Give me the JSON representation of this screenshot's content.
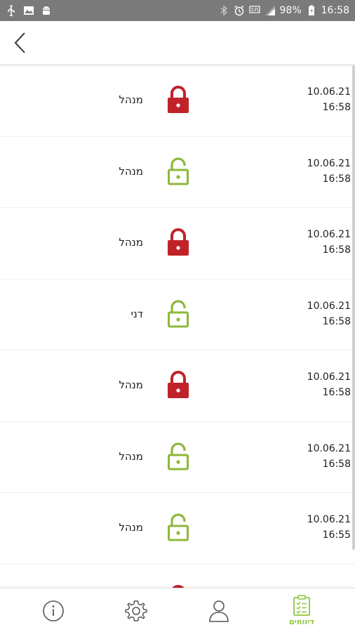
{
  "status_bar": {
    "battery": "98%",
    "time": "16:58",
    "icons": [
      "usb-icon",
      "image-icon",
      "android-icon",
      "bluetooth-icon",
      "alarm-icon",
      "volte-icon",
      "signal-icon",
      "battery-icon"
    ]
  },
  "header": {
    "back_icon": "chevron-left-icon"
  },
  "colors": {
    "locked": "#c0222a",
    "unlocked": "#8db83a",
    "accent": "#8dc63f"
  },
  "log": {
    "rows": [
      {
        "user": "מנהל",
        "state": "locked",
        "date": "10.06.21",
        "time": "16:58"
      },
      {
        "user": "מנהל",
        "state": "unlocked",
        "date": "10.06.21",
        "time": "16:58"
      },
      {
        "user": "מנהל",
        "state": "locked",
        "date": "10.06.21",
        "time": "16:58"
      },
      {
        "user": "דני",
        "state": "unlocked",
        "date": "10.06.21",
        "time": "16:58"
      },
      {
        "user": "מנהל",
        "state": "locked",
        "date": "10.06.21",
        "time": "16:58"
      },
      {
        "user": "מנהל",
        "state": "unlocked",
        "date": "10.06.21",
        "time": "16:58"
      },
      {
        "user": "מנהל",
        "state": "unlocked",
        "date": "10.06.21",
        "time": "16:55"
      },
      {
        "user": "",
        "state": "locked",
        "date": "",
        "time": ""
      }
    ]
  },
  "bottom_nav": {
    "items": [
      {
        "icon": "info-icon",
        "label": ""
      },
      {
        "icon": "gear-icon",
        "label": ""
      },
      {
        "icon": "user-icon",
        "label": ""
      },
      {
        "icon": "reports-icon",
        "label": "דיווחים",
        "active": true
      }
    ]
  }
}
